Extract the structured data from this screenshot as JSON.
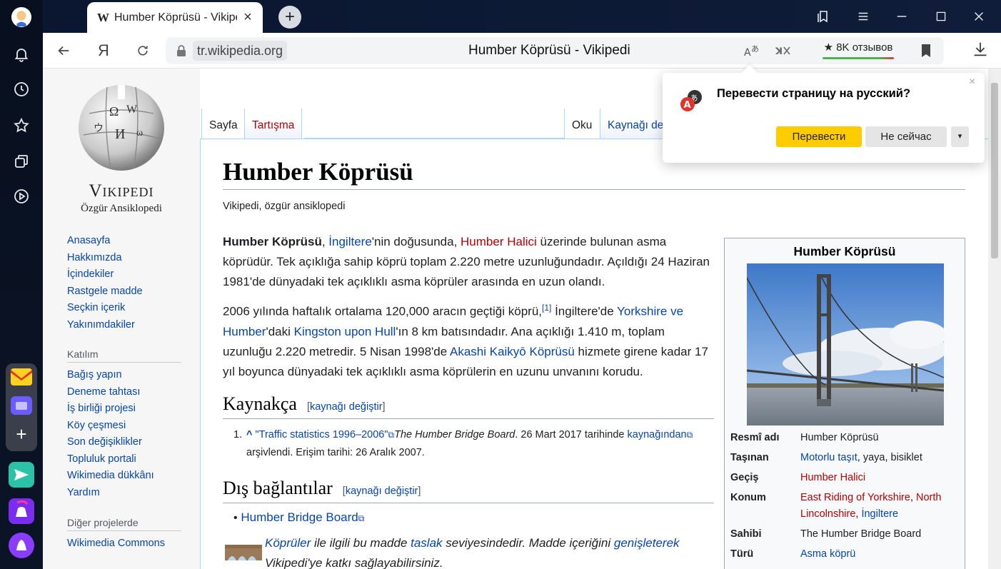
{
  "browser": {
    "tab_title": "Humber Köprüsü - Vikipedi",
    "tab_icon": "W",
    "new_tab_label": "+",
    "domain": "tr.wikipedia.org",
    "page_title": "Humber Köprüsü - Vikipedi",
    "yandex_btn": "Я",
    "reviews": "★ 8K отзывов",
    "accent_yellow": "#ffcc00"
  },
  "translate_popup": {
    "question": "Перевести страницу на русский?",
    "translate": "Перевести",
    "not_now": "Не сейчас",
    "more": "▾"
  },
  "wiki": {
    "logo_title": "Vikipedi",
    "logo_sub": "Özgür Ansiklopedi",
    "nav_main": [
      "Anasayfa",
      "Hakkımızda",
      "İçindekiler",
      "Rastgele madde",
      "Seçkin içerik",
      "Yakınımdakiler"
    ],
    "nav_participation_head": "Katılım",
    "nav_participation": [
      "Bağış yapın",
      "Deneme tahtası",
      "İş birliği projesi",
      "Köy çeşmesi",
      "Son değişiklikler",
      "Topluluk portali",
      "Wikimedia dükkânı",
      "Yardım"
    ],
    "nav_other_head": "Diğer projelerde",
    "nav_other": [
      "Wikimedia Commons"
    ],
    "tabs": {
      "page": "Sayfa",
      "talk": "Tartışma",
      "read": "Oku",
      "edit_source": "Kaynağı değiştir"
    },
    "heading": "Humber Köprüsü",
    "site_sub": "Vikipedi, özgür ansiklopedi",
    "p1": {
      "bold": "Humber Köprüsü",
      "t1": ", ",
      "link1": "İngiltere",
      "t2": "'nin doğusunda, ",
      "link2": "Humber Halici",
      "t3": " üzerinde bulunan asma köprüdür. Tek açıklığa sahip köprü toplam 2.220 metre uzunluğundadır. Açıldığı 24 Haziran 1981'de dünyadaki tek açıklıklı asma köprüler arasında en uzun olandı."
    },
    "p2": {
      "t1": "2006 yılında haftalık ortalama 120,000 aracın geçtiği köprü,",
      "sup": "[1]",
      "t2": " İngiltere'de ",
      "link1": "Yorkshire ve Humber",
      "t3": "'daki ",
      "link2": "Kingston upon Hull",
      "t4": "'ın 8 km batısındadır. Ana açıklığı 1.410 m, toplam uzunluğu 2.220 metredir. 5 Nisan 1998'de ",
      "link3": "Akashi Kaikyō Köprüsü",
      "t5": " hizmete girene kadar 17 yıl boyunca dünyadaki tek açıklıklı asma köprülerin en uzunu unvanını korudu."
    },
    "h_refs": "Kaynakça",
    "h_ext": "Dış bağlantılar",
    "edit_link": "kaynağı değiştir",
    "ref1": {
      "num": "1.",
      "caret": "^",
      "link": "\"Traffic statistics 1996–2006\"",
      "italic": "The Humber Bridge Board",
      "t1": ". 26 Mart 2017 tarihinde ",
      "link2": "kaynağından",
      "t2": " arşivlendi. Erişim tarihi: 26 Aralık 2007."
    },
    "ext_link": "Humber Bridge Board",
    "stub": {
      "link1": "Köprüler",
      "t1": " ile ilgili bu madde ",
      "link2": "taslak",
      "t2": " seviyesindedir. Madde içeriğini ",
      "link3": "genişleterek",
      "t3": " Vikipedi'ye katkı sağlayabilirsiniz."
    },
    "infobox": {
      "title": "Humber Köprüsü",
      "rows": [
        {
          "key": "Resmî adı",
          "value": "Humber Köprüsü"
        },
        {
          "key": "Taşınan",
          "link": "Motorlu taşıt",
          "value": ", yaya, bisiklet"
        },
        {
          "key": "Geçiş",
          "red": "Humber Halici"
        },
        {
          "key": "Konum",
          "red1": "East Riding of Yorkshire",
          "sep": ", ",
          "red2": "North Lincolnshire",
          "sep2": ", ",
          "link": "İngiltere"
        },
        {
          "key": "Sahibi",
          "value": "The Humber Bridge Board"
        },
        {
          "key": "Türü",
          "link": "Asma köprü"
        }
      ]
    }
  }
}
